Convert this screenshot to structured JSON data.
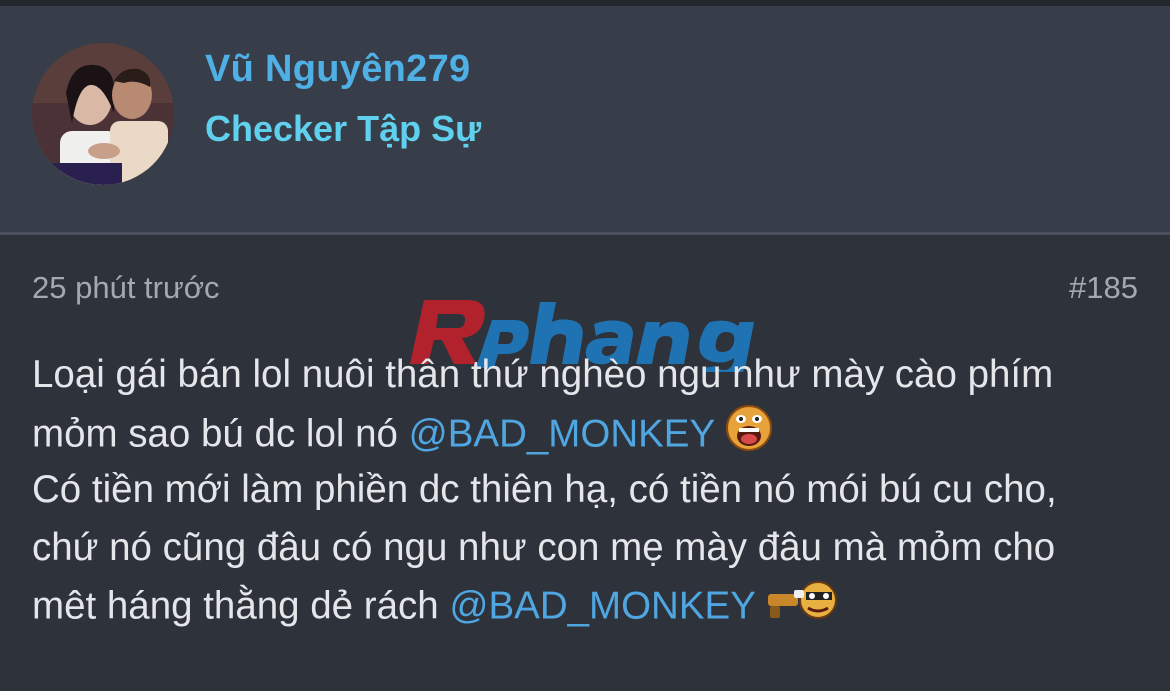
{
  "user": {
    "name": "Vũ Nguyên279",
    "rank": "Checker Tập Sự"
  },
  "post": {
    "time": "25 phút trước",
    "number": "#185",
    "lines": {
      "l1": "Loại gái bán lol nuôi thân thứ nghèo ngu như mày cào phím",
      "l2a": "mỏm sao bú dc lol nó ",
      "mention1": "@BAD_MONKEY",
      "l3": "Có tiền mới làm phiền dc thiên hạ, có tiền nó mói bú cu cho,",
      "l4": "chứ nó cũng đâu có ngu như con mẹ mày đâu mà mỏm cho",
      "l5a": "mêt háng thằng dẻ rách ",
      "mention2": "@BAD_MONKEY"
    },
    "emojis": [
      "shocked-emoji",
      "gun-emoji"
    ]
  },
  "watermark": {
    "text": "Rphang"
  },
  "colors": {
    "background": "#2e323b",
    "header": "#383e49",
    "username": "#4fb0e6",
    "rank": "#5fd0ee",
    "mention": "#4fa6e0",
    "text": "#e4e6ea",
    "muted": "#a4a8b0"
  }
}
